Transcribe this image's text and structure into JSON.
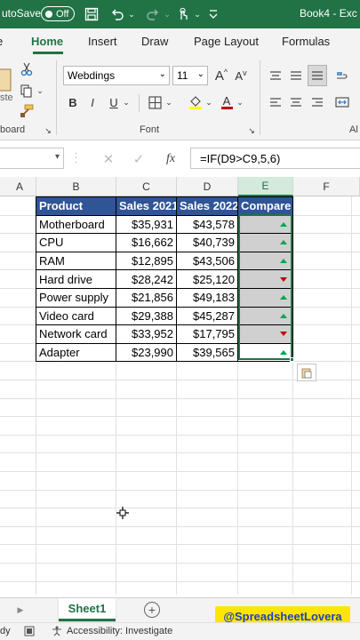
{
  "titlebar": {
    "autosave_label": "utoSave",
    "toggle_label": "Off",
    "book_title": "Book4 - Exc"
  },
  "tabs": [
    {
      "label": "Home",
      "active": true
    },
    {
      "label": "Insert",
      "active": false
    },
    {
      "label": "Draw",
      "active": false
    },
    {
      "label": "Page Layout",
      "active": false
    },
    {
      "label": "Formulas",
      "active": false
    }
  ],
  "ribbon": {
    "font_name": "Webdings",
    "font_size": "11",
    "clipboard_label": "board",
    "font_group_label": "Font",
    "alignment_label": "Al"
  },
  "formula_bar": {
    "formula": "=IF(D9>C9,5,6)"
  },
  "columns": [
    "A",
    "B",
    "C",
    "D",
    "E",
    "F"
  ],
  "table": {
    "headers": [
      "Product",
      "Sales 2021",
      "Sales 2022",
      "Compare"
    ],
    "rows": [
      {
        "product": "Motherboard",
        "s2021": "$35,931",
        "s2022": "$43,578",
        "trend": "up"
      },
      {
        "product": "CPU",
        "s2021": "$16,662",
        "s2022": "$40,739",
        "trend": "up"
      },
      {
        "product": "RAM",
        "s2021": "$12,895",
        "s2022": "$43,506",
        "trend": "up"
      },
      {
        "product": "Hard drive",
        "s2021": "$28,242",
        "s2022": "$25,120",
        "trend": "down"
      },
      {
        "product": "Power supply",
        "s2021": "$21,856",
        "s2022": "$49,183",
        "trend": "up"
      },
      {
        "product": "Video card",
        "s2021": "$29,388",
        "s2022": "$45,287",
        "trend": "up"
      },
      {
        "product": "Network card",
        "s2021": "$33,952",
        "s2022": "$17,795",
        "trend": "down"
      },
      {
        "product": "Adapter",
        "s2021": "$23,990",
        "s2022": "$39,565",
        "trend": "up"
      }
    ]
  },
  "sheetbar": {
    "sheet_tab": "Sheet1",
    "watermark": "@SpreadsheetLovera"
  },
  "statusbar": {
    "ready": "dy",
    "accessibility": "Accessibility: Investigate"
  },
  "colors": {
    "excel_green": "#217346",
    "header_blue": "#2f5597",
    "up_green": "#00a650",
    "down_red": "#c00000",
    "watermark_yellow": "#ffe600"
  }
}
